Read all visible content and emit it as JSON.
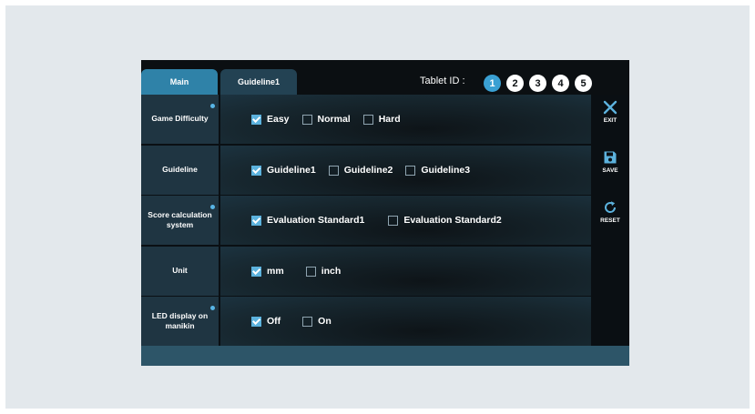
{
  "tabs": [
    {
      "label": "Main",
      "active": true
    },
    {
      "label": "Guideline1",
      "active": false
    }
  ],
  "tablet": {
    "label": "Tablet ID :",
    "ids": [
      "1",
      "2",
      "3",
      "4",
      "5"
    ],
    "active_index": 0
  },
  "settings": [
    {
      "label": "Game Difficulty",
      "dot": true,
      "options": [
        {
          "label": "Easy",
          "checked": true
        },
        {
          "label": "Normal",
          "checked": false
        },
        {
          "label": "Hard",
          "checked": false
        }
      ]
    },
    {
      "label": "Guideline",
      "dot": false,
      "options": [
        {
          "label": "Guideline1",
          "checked": true
        },
        {
          "label": "Guideline2",
          "checked": false
        },
        {
          "label": "Guideline3",
          "checked": false
        }
      ]
    },
    {
      "label": "Score calculation system",
      "dot": true,
      "options": [
        {
          "label": "Evaluation Standard1",
          "checked": true
        },
        {
          "label": "Evaluation Standard2",
          "checked": false
        }
      ]
    },
    {
      "label": "Unit",
      "dot": false,
      "options": [
        {
          "label": "mm",
          "checked": true
        },
        {
          "label": "inch",
          "checked": false
        }
      ]
    },
    {
      "label": "LED display on manikin",
      "dot": true,
      "options": [
        {
          "label": "Off",
          "checked": true
        },
        {
          "label": "On",
          "checked": false
        }
      ]
    }
  ],
  "actions": {
    "exit": {
      "label": "EXIT",
      "icon": "close-icon"
    },
    "save": {
      "label": "SAVE",
      "icon": "save-icon"
    },
    "reset": {
      "label": "RESET",
      "icon": "reset-icon"
    }
  },
  "colors": {
    "accent": "#3aa0d3",
    "tab_active": "#2f82a8",
    "tab_inactive": "#234253",
    "row_label_bg": "#1f3542",
    "bottom_bar": "#2d5568"
  }
}
